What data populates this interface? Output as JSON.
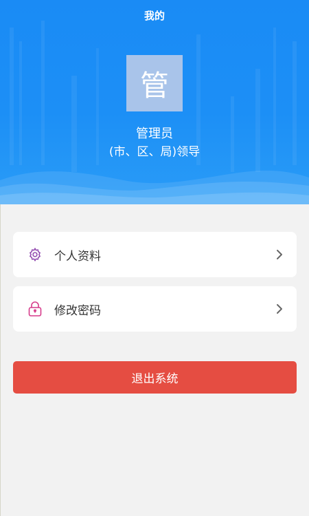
{
  "header": {
    "title": "我的",
    "bg_color": "#1a8bf5"
  },
  "user": {
    "avatar_char": "管",
    "name": "管理员",
    "role": "(市、区、局)领导"
  },
  "menu": {
    "items": [
      {
        "label": "个人资料",
        "icon": "gear-icon",
        "icon_color": "#8e44ad"
      },
      {
        "label": "修改密码",
        "icon": "lock-icon",
        "icon_color": "#d63a8a"
      }
    ]
  },
  "logout": {
    "label": "退出系统",
    "color": "#e54d42"
  }
}
